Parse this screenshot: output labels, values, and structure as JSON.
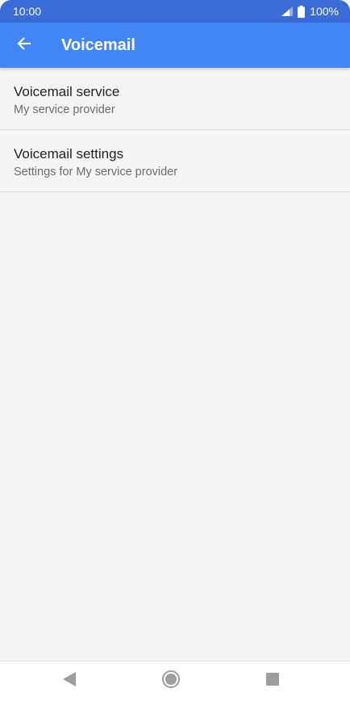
{
  "status_bar": {
    "time": "10:00",
    "battery_text": "100%",
    "icons": [
      "signal-icon",
      "battery-icon"
    ]
  },
  "app_bar": {
    "title": "Voicemail",
    "back_icon": "arrow-back-icon",
    "color": "#4285f4"
  },
  "list": {
    "items": [
      {
        "title": "Voicemail service",
        "subtitle": "My service provider"
      },
      {
        "title": "Voicemail settings",
        "subtitle": "Settings for My service provider"
      }
    ]
  },
  "nav_bar": {
    "icons": [
      "nav-back-icon",
      "nav-home-icon",
      "nav-recents-icon"
    ]
  }
}
